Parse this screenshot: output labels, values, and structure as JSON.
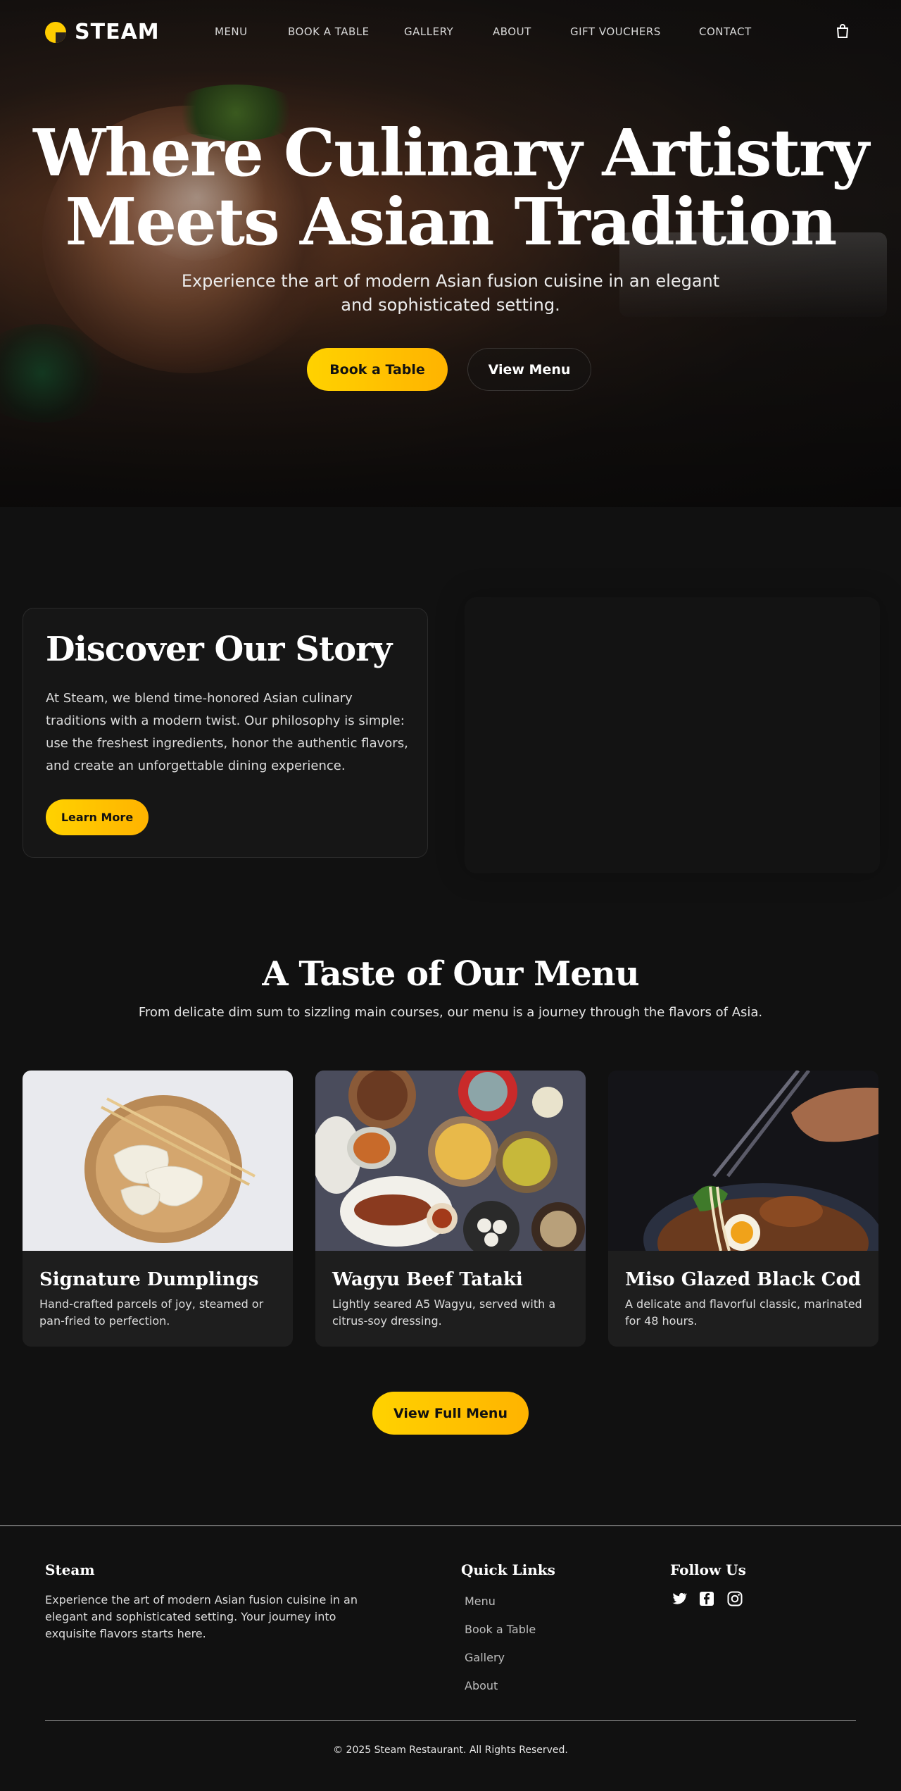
{
  "brand": {
    "name": "STEAM",
    "accent": "#ffcc00"
  },
  "nav": {
    "links": [
      "MENU",
      "BOOK A TABLE",
      "GALLERY",
      "ABOUT",
      "GIFT VOUCHERS",
      "CONTACT"
    ],
    "cart_icon": "shopping-bag-icon"
  },
  "hero": {
    "title_line1": "Where Culinary Artistry",
    "title_line2": "Meets Asian Tradition",
    "subtitle": "Experience the art of modern Asian fusion cuisine in an elegant and sophisticated setting.",
    "book_label": "Book a Table",
    "menu_label": "View Menu"
  },
  "story": {
    "title": "Discover Our Story",
    "text": "At Steam, we blend time-honored Asian culinary traditions with a modern twist. Our philosophy is simple: use the freshest ingredients, honor the authentic flavors, and create an unforgettable dining experience.",
    "button_label": "Learn More"
  },
  "menu_section": {
    "title": "A Taste of Our Menu",
    "subtitle": "From delicate dim sum to sizzling main courses, our menu is a journey through the flavors of Asia.",
    "items": [
      {
        "title": "Signature Dumplings",
        "desc": "Hand-crafted parcels of joy, steamed or pan-fried to perfection."
      },
      {
        "title": "Wagyu Beef Tataki",
        "desc": "Lightly seared A5 Wagyu, served with a citrus-soy dressing."
      },
      {
        "title": "Miso Glazed Black Cod",
        "desc": "A delicate and flavorful classic, marinated for 48 hours."
      }
    ],
    "view_full_label": "View Full Menu"
  },
  "footer": {
    "brand": "Steam",
    "description": "Experience the art of modern Asian fusion cuisine in an elegant and sophisticated setting. Your journey into exquisite flavors starts here.",
    "quick_links_title": "Quick Links",
    "quick_links": [
      "Menu",
      "Book a Table",
      "Gallery",
      "About"
    ],
    "follow_title": "Follow Us",
    "social_icons": [
      "twitter-icon",
      "facebook-icon",
      "instagram-icon"
    ],
    "copyright": "© 2025 Steam Restaurant. All Rights Reserved."
  }
}
